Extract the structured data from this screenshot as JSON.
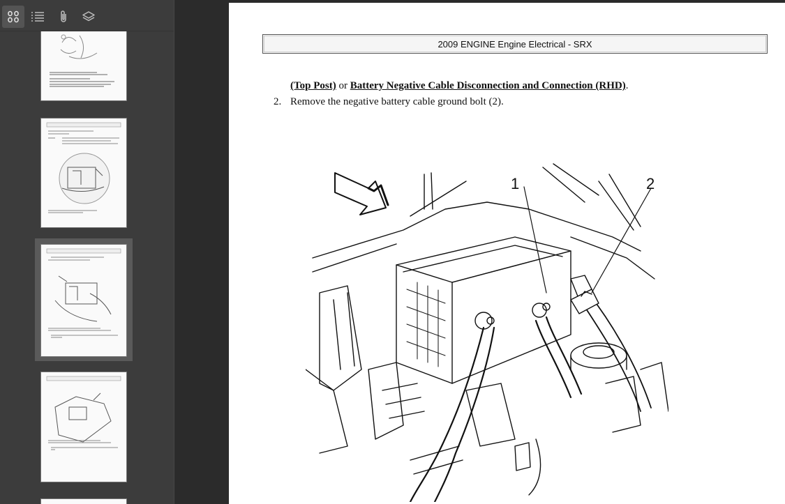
{
  "sidebar": {
    "toolbar": {
      "thumbnails_icon": "grid-icon",
      "outline_icon": "list-icon",
      "attachments_icon": "paperclip-icon",
      "layers_icon": "layers-icon"
    },
    "selected_thumbnail": 3
  },
  "document": {
    "header": "2009 ENGINE Engine Electrical - SRX",
    "link1": "(Top Post)",
    "or_text": " or ",
    "link2": "Battery Negative Cable Disconnection and Connection (RHD)",
    "link_end": ".",
    "step_number": "2.",
    "step_text": "Remove the negative battery cable ground bolt (2).",
    "figure_callouts": [
      "1",
      "2"
    ]
  },
  "colors": {
    "sidebar_bg": "#3c3c3c",
    "viewer_bg": "#2b2b2b",
    "selection": "#5a5a5a",
    "page_bg": "#ffffff"
  }
}
